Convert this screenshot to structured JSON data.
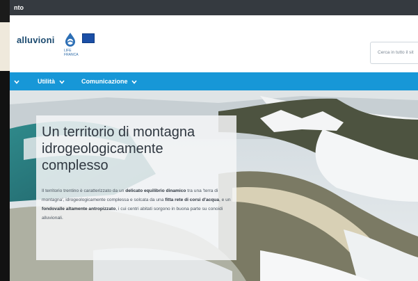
{
  "topbar": {
    "text": "nto"
  },
  "header": {
    "brand": "alluvioni",
    "logo_subtext": [
      "LIFE",
      "FRANCA"
    ],
    "search_placeholder": "Cerca in tutto il sit"
  },
  "nav": {
    "items": [
      {
        "label": ""
      },
      {
        "label": "Utilità"
      },
      {
        "label": "Comunicazione"
      }
    ]
  },
  "hero": {
    "title": "Un territorio di montagna idrogeologicamente complesso",
    "paragraph": [
      {
        "text": "Il territorio trentino è caratterizzato da un ",
        "bold": false
      },
      {
        "text": "delicato equilibrio dinamico",
        "bold": true
      },
      {
        "text": " tra una 'terra di montagna', idrogeologicamente complessa e solcata da una ",
        "bold": false
      },
      {
        "text": "fitta rete di corsi d'acqua",
        "bold": true
      },
      {
        "text": ", e un ",
        "bold": false
      },
      {
        "text": "fondovalle altamente antropizzato",
        "bold": true
      },
      {
        "text": ", i cui centri abitati sorgono in buona parte su conoidi alluvionali.",
        "bold": false
      }
    ]
  }
}
